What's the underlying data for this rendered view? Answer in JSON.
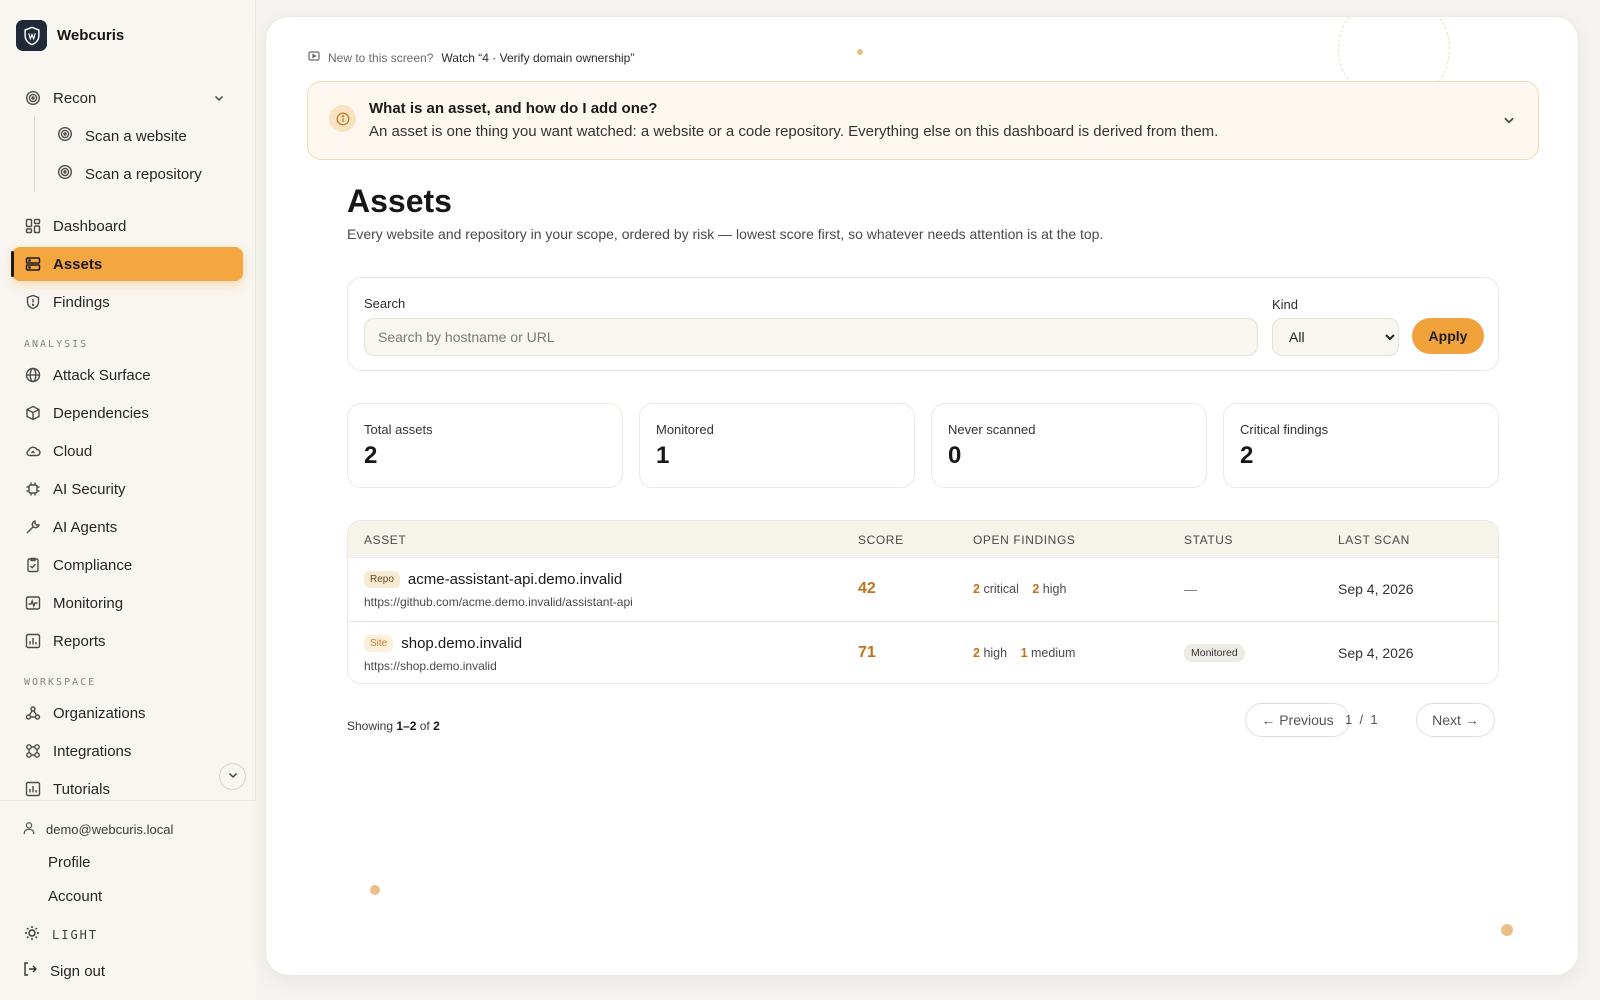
{
  "brand": {
    "name": "Webcuris"
  },
  "sidebar": {
    "recon": {
      "label": "Recon",
      "children": [
        {
          "label": "Scan a website"
        },
        {
          "label": "Scan a repository"
        }
      ]
    },
    "main_items": [
      {
        "label": "Dashboard",
        "icon": "dashboard-icon"
      },
      {
        "label": "Assets",
        "icon": "server-icon",
        "active": true
      },
      {
        "label": "Findings",
        "icon": "shield-icon"
      }
    ],
    "analysis_label": "ANALYSIS",
    "analysis_items": [
      {
        "label": "Attack Surface",
        "icon": "globe-icon"
      },
      {
        "label": "Dependencies",
        "icon": "package-icon"
      },
      {
        "label": "Cloud",
        "icon": "cloud-icon"
      },
      {
        "label": "AI Security",
        "icon": "cpu-icon"
      },
      {
        "label": "AI Agents",
        "icon": "wrench-icon"
      },
      {
        "label": "Compliance",
        "icon": "checklist-icon"
      },
      {
        "label": "Monitoring",
        "icon": "pulse-icon"
      },
      {
        "label": "Reports",
        "icon": "bar-chart-icon"
      }
    ],
    "workspace_label": "WORKSPACE",
    "workspace_items": [
      {
        "label": "Organizations",
        "icon": "org-icon"
      },
      {
        "label": "Integrations",
        "icon": "puzzle-icon"
      },
      {
        "label": "Tutorials",
        "icon": "bar-chart-icon"
      }
    ],
    "footer": {
      "user_email": "demo@webcuris.local",
      "profile": "Profile",
      "account": "Account",
      "theme": "LIGHT",
      "sign_out": "Sign out"
    }
  },
  "main": {
    "watch_prefix": "New to this screen?",
    "watch_link": "Watch “4 · Verify domain ownership”",
    "info": {
      "title": "What is an asset, and how do I add one?",
      "body": "An asset is one thing you want watched: a website or a code repository. Everything else on this dashboard is derived from them."
    },
    "title": "Assets",
    "subtitle": "Every website and repository in your scope, ordered by risk — lowest score first, so whatever needs attention is at the top.",
    "filters": {
      "search_label": "Search",
      "search_placeholder": "Search by hostname or URL",
      "search_value": "",
      "kind_label": "Kind",
      "kind_value": "All",
      "apply_label": "Apply"
    },
    "stats": [
      {
        "label": "Total assets",
        "value": "2"
      },
      {
        "label": "Monitored",
        "value": "1"
      },
      {
        "label": "Never scanned",
        "value": "0"
      },
      {
        "label": "Critical findings",
        "value": "2"
      }
    ],
    "table": {
      "headers": [
        "ASSET",
        "SCORE",
        "OPEN FINDINGS",
        "STATUS",
        "LAST SCAN"
      ],
      "rows": [
        {
          "kind": "Repo",
          "name": "acme-assistant-api.demo.invalid",
          "url": "https://github.com/acme.demo.invalid/assistant-api",
          "score": "42",
          "findings": [
            {
              "count": "2",
              "severity": "critical"
            },
            {
              "count": "2",
              "severity": "high"
            }
          ],
          "status": "—",
          "last_scan": "Sep 4, 2026"
        },
        {
          "kind": "Site",
          "name": "shop.demo.invalid",
          "url": "https://shop.demo.invalid",
          "score": "71",
          "findings": [
            {
              "count": "2",
              "severity": "high"
            },
            {
              "count": "1",
              "severity": "medium"
            }
          ],
          "status": "Monitored",
          "last_scan": "Sep 4, 2026"
        }
      ]
    },
    "pagination": {
      "showing_prefix": "Showing",
      "showing_range": "1–2",
      "showing_of": "of",
      "showing_total": "2",
      "previous": "← Previous",
      "page_current": "1",
      "page_sep": "/",
      "page_total": "1",
      "next": "Next →"
    }
  },
  "colors": {
    "accent": "#f2a23a",
    "score": "#c0721f",
    "background": "#f4f3ef"
  }
}
